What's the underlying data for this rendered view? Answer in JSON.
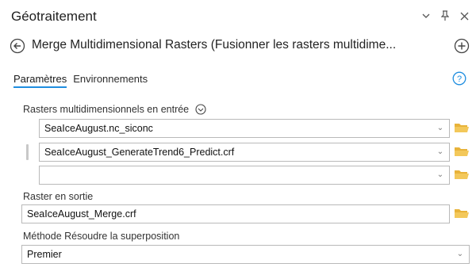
{
  "pane": {
    "title": "Géotraitement",
    "controls": {
      "options_icon": "chevron-down-icon",
      "pin_icon": "pin-icon",
      "close_icon": "close-icon"
    }
  },
  "tool": {
    "title": "Merge Multidimensional Rasters (Fusionner les rasters multidime...",
    "back_icon": "back-arrow-icon",
    "add_icon": "add-circle-icon"
  },
  "tabs": [
    {
      "label": "Paramètres",
      "active": true
    },
    {
      "label": "Environnements",
      "active": false
    }
  ],
  "help_icon": "help-icon",
  "params": {
    "input_label": "Rasters multidimensionnels en entrée",
    "input_rows": [
      {
        "value": "SeaIceAugust.nc_siconc"
      },
      {
        "value": "SeaIceAugust_GenerateTrend6_Predict.crf"
      },
      {
        "value": ""
      }
    ],
    "output_label": "Raster en sortie",
    "output_value": "SeaIceAugust_Merge.crf",
    "overlap_label": "Méthode Résoudre la superposition",
    "overlap_value": "Premier"
  },
  "colors": {
    "accent": "#1f8ee0",
    "folder": "#e8b33a",
    "border": "#b9b9b9"
  }
}
